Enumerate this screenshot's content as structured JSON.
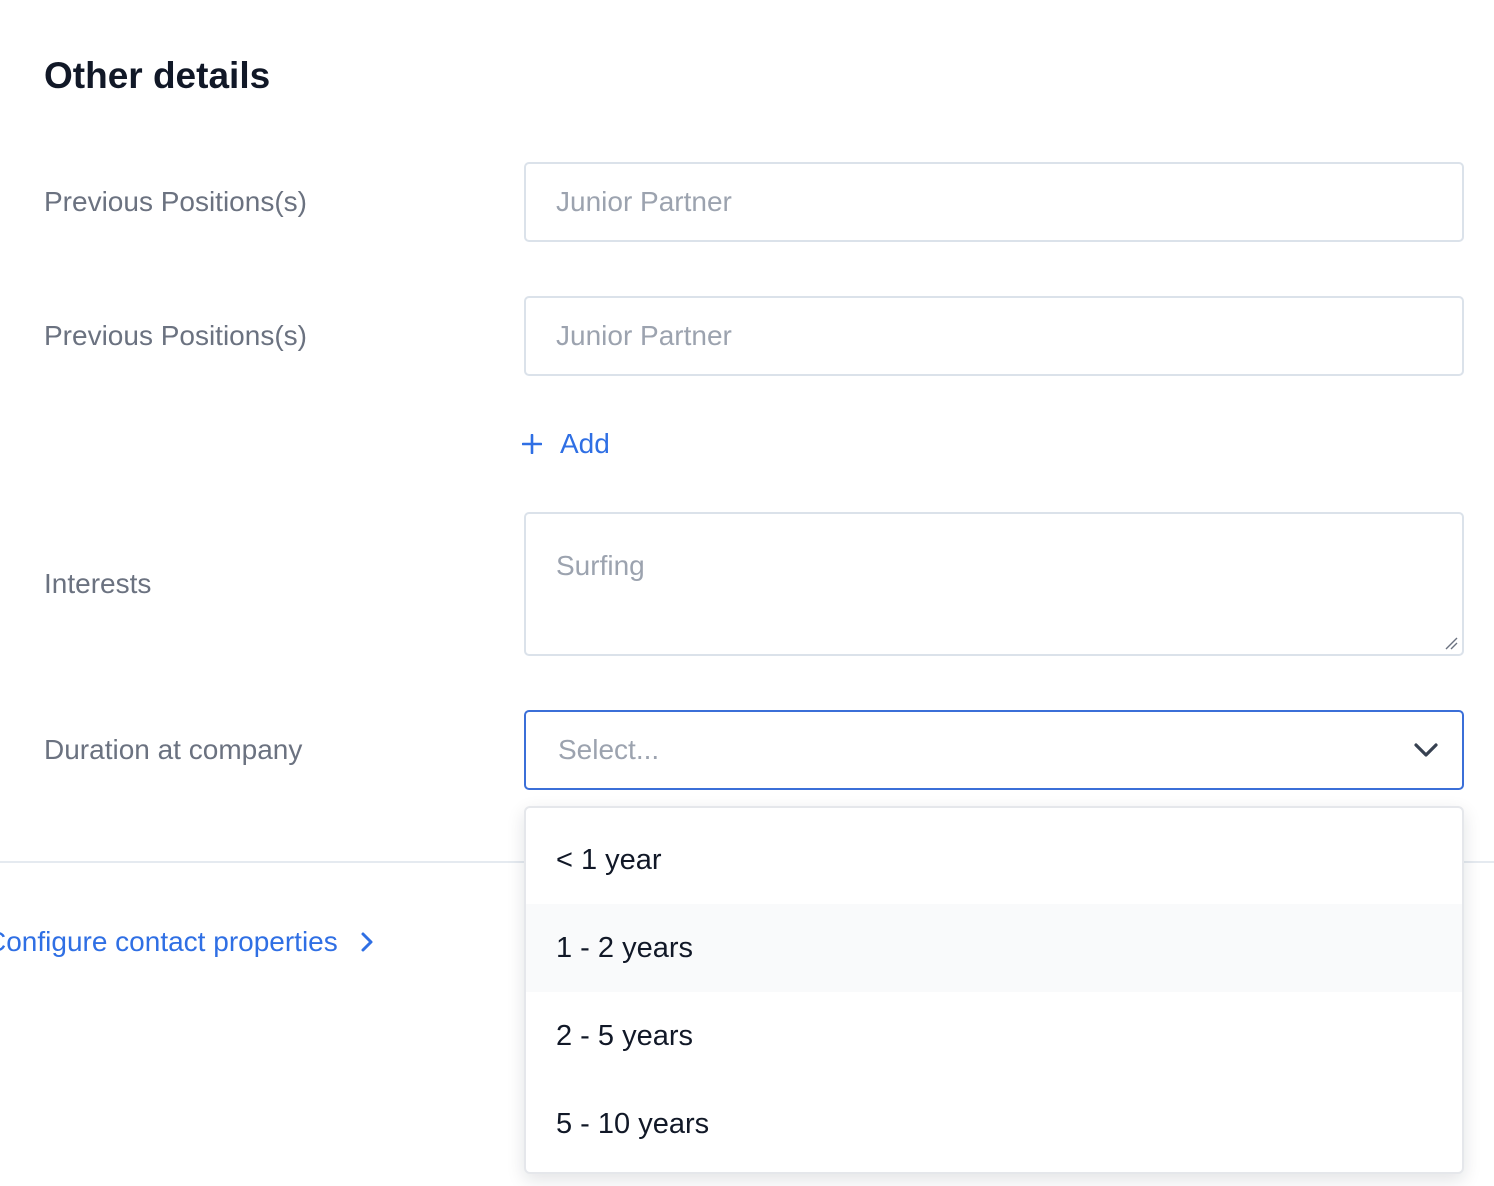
{
  "section": {
    "title": "Other details"
  },
  "fields": {
    "previous_positions_1": {
      "label": "Previous Positions(s)",
      "placeholder": "Junior Partner"
    },
    "previous_positions_2": {
      "label": "Previous Positions(s)",
      "placeholder": "Junior Partner"
    },
    "add_label": "Add",
    "interests": {
      "label": "Interests",
      "placeholder": "Surfing"
    },
    "duration": {
      "label": "Duration at company",
      "placeholder": "Select..."
    }
  },
  "dropdown": {
    "options": [
      "< 1 year",
      "1 - 2 years",
      "2 - 5 years",
      "5 - 10 years"
    ],
    "hovered_index": 1
  },
  "footer": {
    "configure_link": "Configure contact properties"
  },
  "colors": {
    "accent": "#2f6fe4",
    "focus_border": "#3b6fd8",
    "label": "#6b7280",
    "title": "#111827",
    "placeholder": "#9ca3af"
  },
  "icons": {
    "add": "plus-icon",
    "select": "chevron-down-icon",
    "link": "chevron-right-icon"
  }
}
